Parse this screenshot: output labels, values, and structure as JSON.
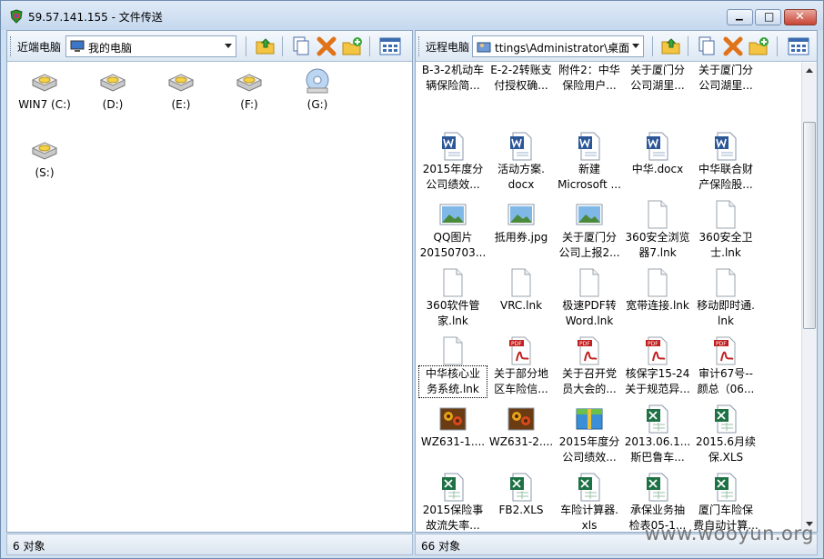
{
  "window": {
    "title": "59.57.141.155 - 文件传送",
    "min_glyph": "▁",
    "max_glyph": "□",
    "close_glyph": "✕"
  },
  "local": {
    "label": "近端电脑",
    "location": "我的电脑",
    "items": [
      {
        "label": "WIN7 (C:)",
        "icon": "drive-icon"
      },
      {
        "label": "(D:)",
        "icon": "drive-icon"
      },
      {
        "label": "(E:)",
        "icon": "drive-icon"
      },
      {
        "label": "(F:)",
        "icon": "drive-icon"
      },
      {
        "label": "(G:)",
        "icon": "cd-drive-icon"
      },
      {
        "label": "(S:)",
        "icon": "drive-icon"
      }
    ],
    "status": "6 对象"
  },
  "remote": {
    "label": "远程电脑",
    "location": "ttings\\Administrator\\桌面",
    "items": [
      {
        "label": "B-3-2机动车\n辆保险简...",
        "icon": "none"
      },
      {
        "label": "E-2-2转账支\n付授权确...",
        "icon": "none"
      },
      {
        "label": "附件2：中华\n保险用户...",
        "icon": "none"
      },
      {
        "label": "关于厦门分\n公司湖里...",
        "icon": "none"
      },
      {
        "label": "关于厦门分\n公司湖里...",
        "icon": "none"
      },
      {
        "label": "2015年度分\n公司绩效...",
        "icon": "word-icon"
      },
      {
        "label": "活动方案.\ndocx",
        "icon": "word-icon"
      },
      {
        "label": "新建\nMicrosoft ...",
        "icon": "word-icon"
      },
      {
        "label": "中华.docx",
        "icon": "word-icon"
      },
      {
        "label": "中华联合财\n产保险股...",
        "icon": "word-icon"
      },
      {
        "label": "QQ图片\n20150703...",
        "icon": "image-icon"
      },
      {
        "label": "抵用券.jpg",
        "icon": "image-icon"
      },
      {
        "label": "关于厦门分\n公司上报2...",
        "icon": "image-icon"
      },
      {
        "label": "360安全浏览\n器7.lnk",
        "icon": "file-icon"
      },
      {
        "label": "360安全卫\n士.lnk",
        "icon": "file-icon"
      },
      {
        "label": "360软件管\n家.lnk",
        "icon": "file-icon"
      },
      {
        "label": "VRC.lnk",
        "icon": "file-icon"
      },
      {
        "label": "极速PDF转\nWord.lnk",
        "icon": "file-icon"
      },
      {
        "label": "宽带连接.lnk",
        "icon": "file-icon"
      },
      {
        "label": "移动即时通.\nlnk",
        "icon": "file-icon"
      },
      {
        "label": "中华核心业\n务系统.lnk",
        "icon": "file-icon",
        "selected": true
      },
      {
        "label": "关于部分地\n区车险信...",
        "icon": "pdf-icon"
      },
      {
        "label": "关于召开党\n员大会的...",
        "icon": "pdf-icon"
      },
      {
        "label": "核保字15-24\n关于规范异...",
        "icon": "pdf-icon"
      },
      {
        "label": "审计67号--\n颜总（06...",
        "icon": "pdf-icon"
      },
      {
        "label": "WZ631-1....",
        "icon": "flower-icon"
      },
      {
        "label": "WZ631-2....",
        "icon": "flower-icon"
      },
      {
        "label": "2015年度分\n公司绩效...",
        "icon": "archive-icon"
      },
      {
        "label": "2013.06.1...\n斯巴鲁车...",
        "icon": "excel-icon"
      },
      {
        "label": "2015.6月续\n保.XLS",
        "icon": "excel-icon"
      },
      {
        "label": "2015保险事\n故流失率...",
        "icon": "excel-icon"
      },
      {
        "label": "FB2.XLS",
        "icon": "excel-icon"
      },
      {
        "label": "车险计算器.\nxls",
        "icon": "excel-icon"
      },
      {
        "label": "承保业务抽\n检表05-1...",
        "icon": "excel-icon"
      },
      {
        "label": "厦门车险保\n费自动计算...",
        "icon": "excel-icon"
      },
      {
        "label": "",
        "icon": "excel-icon"
      },
      {
        "label": "",
        "icon": "excel-icon"
      },
      {
        "label": "",
        "icon": "excel-icon"
      },
      {
        "label": "",
        "icon": "excel-icon"
      },
      {
        "label": "",
        "icon": "excel-icon"
      }
    ],
    "status": "66 对象"
  },
  "watermark": "www.wooyun.org"
}
